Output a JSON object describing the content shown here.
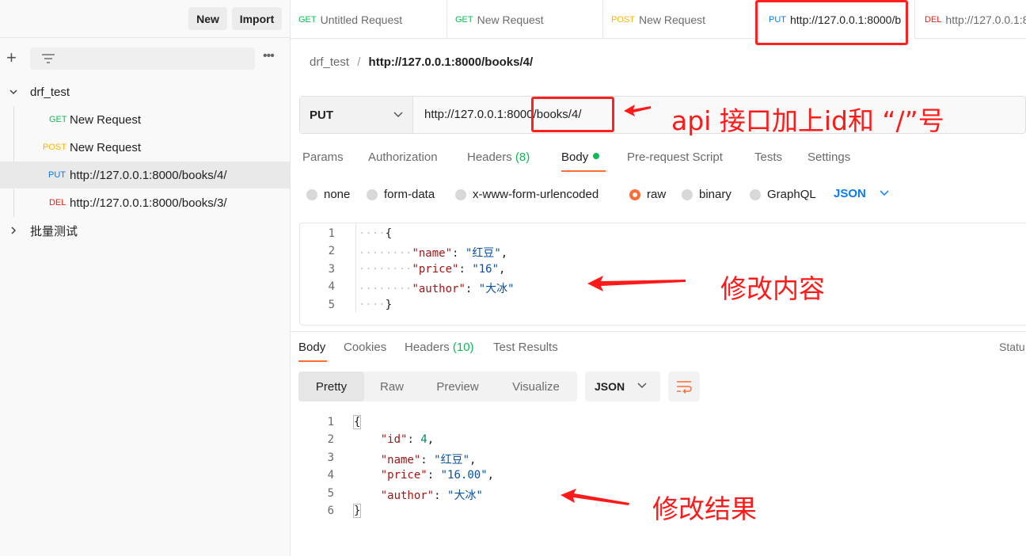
{
  "sidebar": {
    "new_label": "New",
    "import_label": "Import",
    "more_label": "•••",
    "tree": [
      {
        "type": "folder",
        "label": "drf_test",
        "expanded": true
      },
      {
        "type": "request",
        "method": "GET",
        "label": "New Request"
      },
      {
        "type": "request",
        "method": "POST",
        "label": "New Request"
      },
      {
        "type": "request",
        "method": "PUT",
        "label": "http://127.0.0.1:8000/books/4/",
        "selected": true
      },
      {
        "type": "request",
        "method": "DEL",
        "label": "http://127.0.0.1:8000/books/3/"
      },
      {
        "type": "folder",
        "label": "批量测试",
        "expanded": false
      }
    ]
  },
  "tabs": [
    {
      "method": "GET",
      "label": "Untitled Request"
    },
    {
      "method": "GET",
      "label": "New Request"
    },
    {
      "method": "POST",
      "label": "New Request"
    },
    {
      "method": "PUT",
      "label": "http://127.0.0.1:8000/b",
      "active": true
    },
    {
      "method": "DEL",
      "label": "http://127.0.0.1:8"
    }
  ],
  "breadcrumb": {
    "collection": "drf_test",
    "separator": "/",
    "request": "http://127.0.0.1:8000/books/4/"
  },
  "request": {
    "method": "PUT",
    "url": "http://127.0.0.1:8000/books/4/",
    "tabs": {
      "params": "Params",
      "authorization": "Authorization",
      "headers": "Headers",
      "headers_count": "(8)",
      "body": "Body",
      "pre_request": "Pre-request Script",
      "tests": "Tests",
      "settings": "Settings"
    },
    "body_types": [
      "none",
      "form-data",
      "x-www-form-urlencoded",
      "raw",
      "binary",
      "GraphQL"
    ],
    "selected_body_type": "raw",
    "language": "JSON",
    "body_lines": [
      "1",
      "2",
      "3",
      "4",
      "5"
    ],
    "body": {
      "name": "红豆",
      "price": "16",
      "author": "大冰"
    }
  },
  "response": {
    "tabs": {
      "body": "Body",
      "cookies": "Cookies",
      "headers": "Headers",
      "headers_count": "(10)",
      "test_results": "Test Results"
    },
    "status_label": "Statu",
    "views": [
      "Pretty",
      "Raw",
      "Preview",
      "Visualize"
    ],
    "active_view": "Pretty",
    "format": "JSON",
    "lines": [
      "1",
      "2",
      "3",
      "4",
      "5",
      "6"
    ],
    "body": {
      "id": "4",
      "name": "红豆",
      "price": "16.00",
      "author": "大冰"
    }
  },
  "annotations": {
    "url_note": "api 接口加上id和 “/”号",
    "body_note": "修改内容",
    "result_note": "修改结果",
    "color": "#ff1a1a"
  },
  "colors": {
    "accent": "#ff6c37",
    "get": "#0cbb52",
    "post": "#ffb400",
    "put": "#097bed",
    "del": "#eb2013"
  }
}
